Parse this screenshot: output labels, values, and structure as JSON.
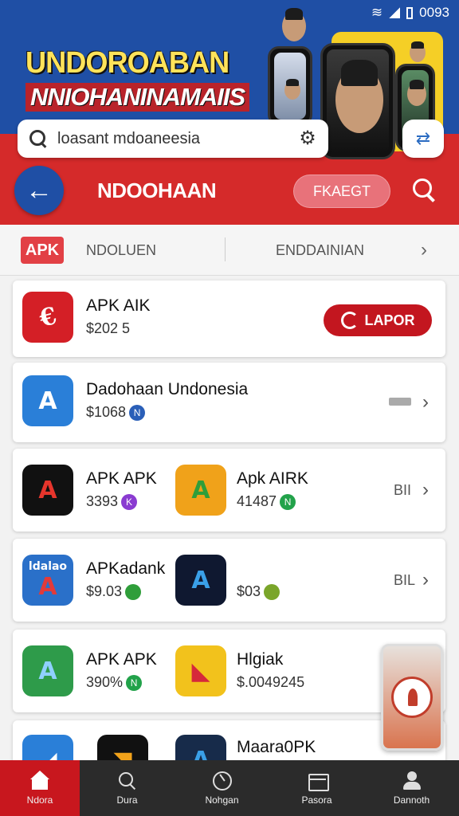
{
  "status_bar": {
    "clock": "0093"
  },
  "banner": {
    "headline_primary": "UNDOROABAN",
    "headline_secondary": "NNIOHANINAMAIIS"
  },
  "search": {
    "value": "loasant mdoaneesia"
  },
  "nav": {
    "title": "NDOOHAAN",
    "filter_label": "FKAEGT"
  },
  "categories": {
    "badge": "APK",
    "left": "NDOLUEN",
    "right": "ENDDAINIAN"
  },
  "apps": [
    {
      "name": "APK AIK",
      "price": "$202 5",
      "action_label": "LAPOR"
    },
    {
      "name": "Dadohaan Undonesia",
      "price": "$1068",
      "price_badge": "N"
    },
    {
      "name": "APK APK",
      "price": "3393",
      "price_badge": "K",
      "name2": "Apk AIRK",
      "price2": "41487",
      "price2_badge": "N",
      "side_text": "BII"
    },
    {
      "name": "APKadank",
      "price": "$9.03",
      "name2": "",
      "price2": "$03",
      "side_text": "BIL",
      "icon_text": "ldalao"
    },
    {
      "name": "APK APK",
      "price": "390%",
      "price_badge": "N",
      "name2": "Hlgiak",
      "price2": "$.0049245"
    },
    {
      "name": "",
      "price": "",
      "name2": "Maara0PK",
      "price2": ""
    }
  ],
  "bottom_nav": [
    {
      "label": "Ndora",
      "icon": "home-icon"
    },
    {
      "label": "Dura",
      "icon": "search-icon"
    },
    {
      "label": "Nohgan",
      "icon": "compass-icon"
    },
    {
      "label": "Pasora",
      "icon": "inbox-icon"
    },
    {
      "label": "Dannoth",
      "icon": "user-icon"
    }
  ],
  "colors": {
    "brand_red": "#c8171e",
    "brand_blue": "#1f4fa5",
    "accent_yellow": "#ffe35a"
  }
}
